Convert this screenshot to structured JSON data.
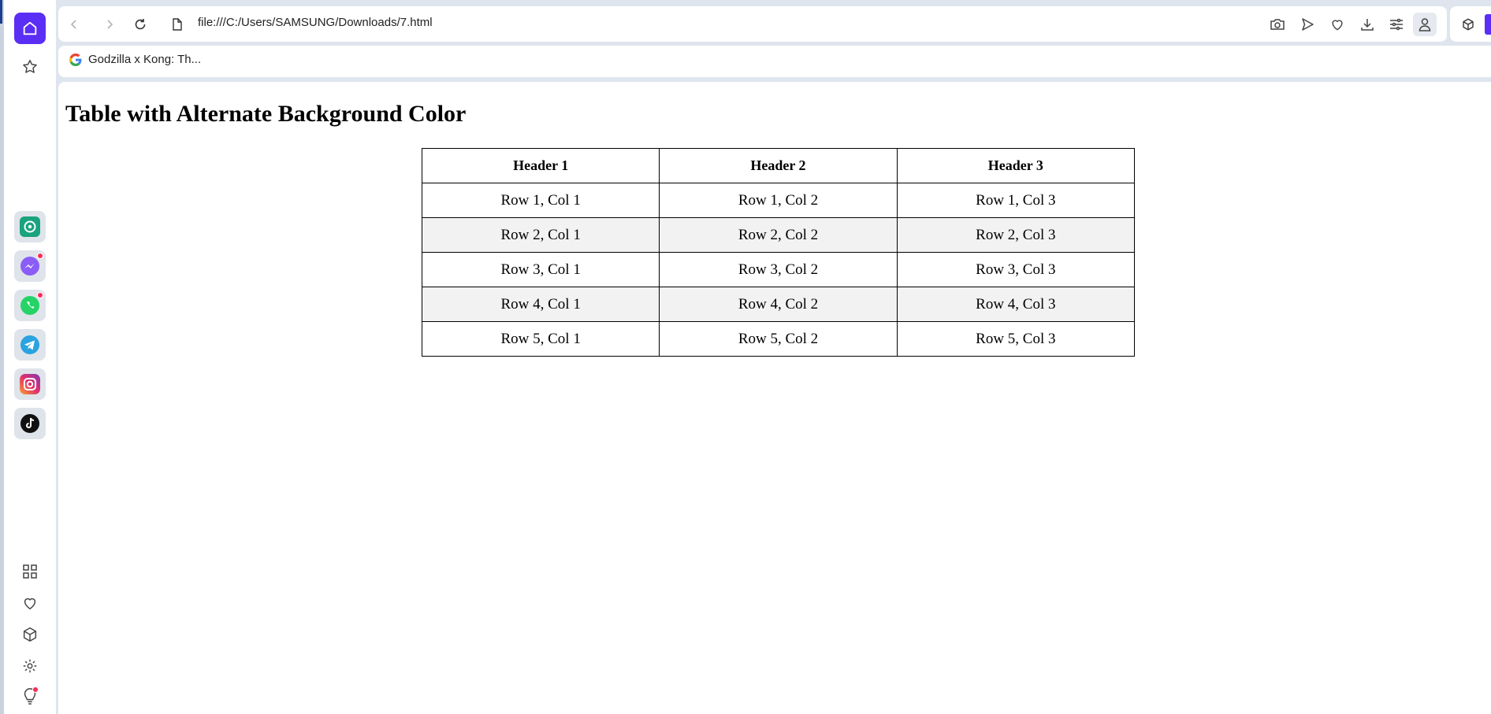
{
  "browser": {
    "url": "file:///C:/Users/SAMSUNG/Downloads/7.html",
    "bookmark_label": "Godzilla x Kong: Th...",
    "accent_color": "#5b2ef5"
  },
  "sidebar": {
    "top_icons": [
      "home-icon",
      "star-icon"
    ],
    "apps": [
      "chatgpt-icon",
      "messenger-icon",
      "whatsapp-icon",
      "telegram-icon",
      "instagram-icon",
      "tiktok-icon"
    ],
    "bottom_icons": [
      "grid-icon",
      "heart-icon",
      "cube-icon",
      "gear-icon",
      "lightbulb-icon"
    ]
  },
  "page": {
    "title": "Table with Alternate Background Color",
    "alt_row_color": "#f2f2f2",
    "table": {
      "headers": [
        "Header 1",
        "Header 2",
        "Header 3"
      ],
      "rows": [
        [
          "Row 1, Col 1",
          "Row 1, Col 2",
          "Row 1, Col 3"
        ],
        [
          "Row 2, Col 1",
          "Row 2, Col 2",
          "Row 2, Col 3"
        ],
        [
          "Row 3, Col 1",
          "Row 3, Col 2",
          "Row 3, Col 3"
        ],
        [
          "Row 4, Col 1",
          "Row 4, Col 2",
          "Row 4, Col 3"
        ],
        [
          "Row 5, Col 1",
          "Row 5, Col 2",
          "Row 5, Col 3"
        ]
      ]
    }
  }
}
